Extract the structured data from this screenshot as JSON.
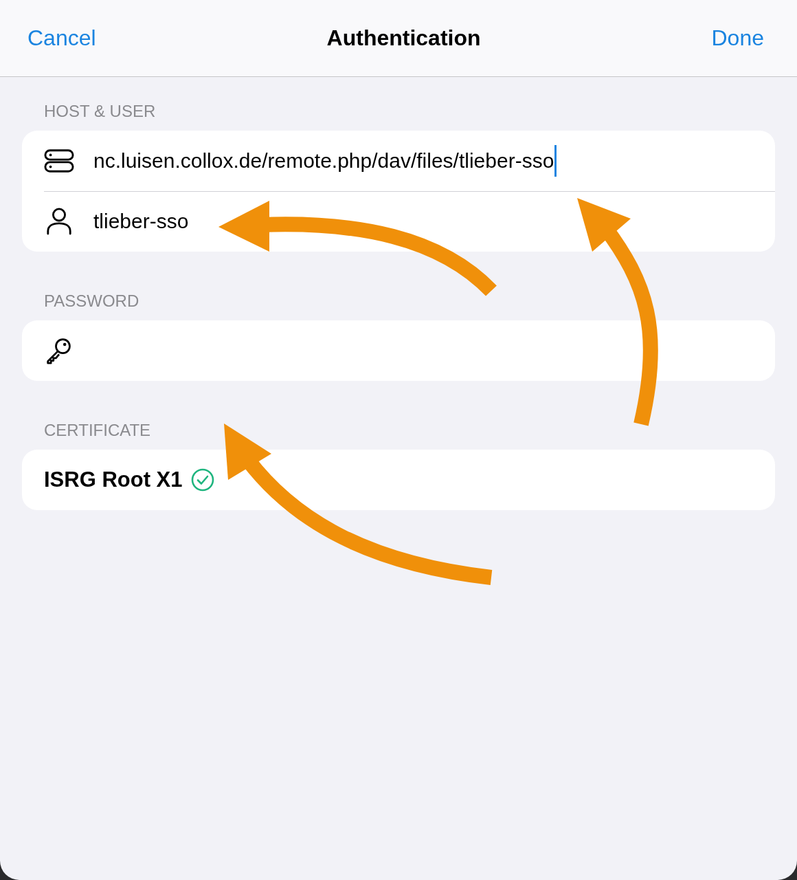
{
  "nav": {
    "cancel": "Cancel",
    "title": "Authentication",
    "done": "Done"
  },
  "sections": [
    {
      "header": "HOST & USER",
      "rows": [
        {
          "kind": "host",
          "value": "nc.luisen.collox.de/remote.php/dav/files/tlieber-sso",
          "focused": true
        },
        {
          "kind": "user",
          "value": "tlieber-sso",
          "focused": false
        }
      ]
    },
    {
      "header": "PASSWORD",
      "rows": [
        {
          "kind": "password",
          "focused": false
        }
      ]
    },
    {
      "header": "CERTIFICATE",
      "rows": [
        {
          "kind": "certificate",
          "value": "ISRG Root X1",
          "verified": true
        }
      ]
    }
  ]
}
